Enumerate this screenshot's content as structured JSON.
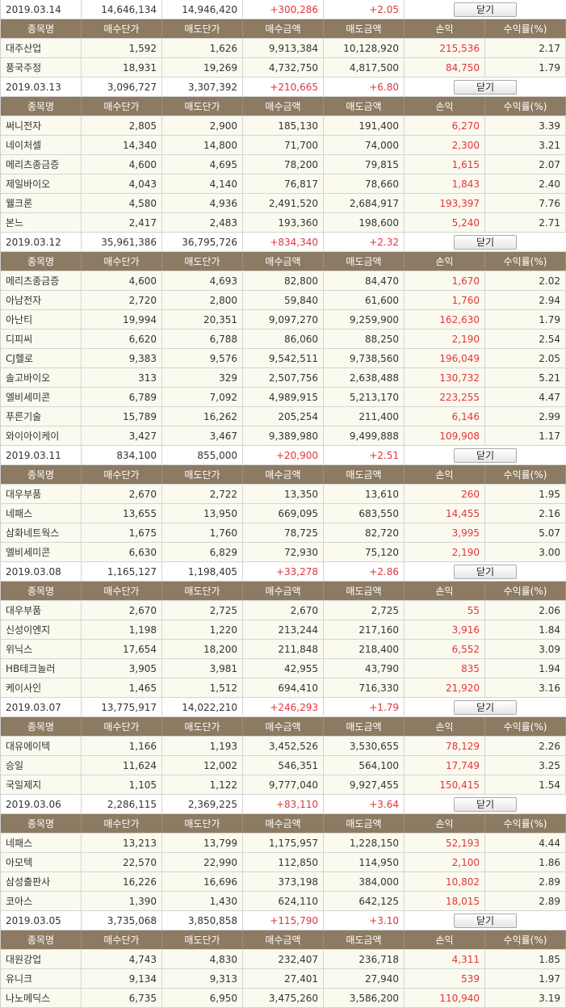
{
  "columns": [
    "종목명",
    "매수단가",
    "매도단가",
    "매수금액",
    "매도금액",
    "손익",
    "수익률(%)"
  ],
  "close_label": "닫기",
  "groups": [
    {
      "date": "2019.03.14",
      "buy_total": "14,646,134",
      "sell_total": "14,946,420",
      "profit": "+300,286",
      "rate": "+2.05",
      "rows": [
        [
          "대주산업",
          "1,592",
          "1,626",
          "9,913,384",
          "10,128,920",
          "215,536",
          "2.17"
        ],
        [
          "풍국주정",
          "18,931",
          "19,269",
          "4,732,750",
          "4,817,500",
          "84,750",
          "1.79"
        ]
      ]
    },
    {
      "date": "2019.03.13",
      "buy_total": "3,096,727",
      "sell_total": "3,307,392",
      "profit": "+210,665",
      "rate": "+6.80",
      "rows": [
        [
          "써니전자",
          "2,805",
          "2,900",
          "185,130",
          "191,400",
          "6,270",
          "3.39"
        ],
        [
          "네이처셀",
          "14,340",
          "14,800",
          "71,700",
          "74,000",
          "2,300",
          "3.21"
        ],
        [
          "메리츠종금증",
          "4,600",
          "4,695",
          "78,200",
          "79,815",
          "1,615",
          "2.07"
        ],
        [
          "제일바이오",
          "4,043",
          "4,140",
          "76,817",
          "78,660",
          "1,843",
          "2.40"
        ],
        [
          "웰크론",
          "4,580",
          "4,936",
          "2,491,520",
          "2,684,917",
          "193,397",
          "7.76"
        ],
        [
          "본느",
          "2,417",
          "2,483",
          "193,360",
          "198,600",
          "5,240",
          "2.71"
        ]
      ]
    },
    {
      "date": "2019.03.12",
      "buy_total": "35,961,386",
      "sell_total": "36,795,726",
      "profit": "+834,340",
      "rate": "+2.32",
      "rows": [
        [
          "메리츠종금증",
          "4,600",
          "4,693",
          "82,800",
          "84,470",
          "1,670",
          "2.02"
        ],
        [
          "아남전자",
          "2,720",
          "2,800",
          "59,840",
          "61,600",
          "1,760",
          "2.94"
        ],
        [
          "아난티",
          "19,994",
          "20,351",
          "9,097,270",
          "9,259,900",
          "162,630",
          "1.79"
        ],
        [
          "디피씨",
          "6,620",
          "6,788",
          "86,060",
          "88,250",
          "2,190",
          "2.54"
        ],
        [
          "CJ헬로",
          "9,383",
          "9,576",
          "9,542,511",
          "9,738,560",
          "196,049",
          "2.05"
        ],
        [
          "솔고바이오",
          "313",
          "329",
          "2,507,756",
          "2,638,488",
          "130,732",
          "5.21"
        ],
        [
          "엘비세미콘",
          "6,789",
          "7,092",
          "4,989,915",
          "5,213,170",
          "223,255",
          "4.47"
        ],
        [
          "푸른기술",
          "15,789",
          "16,262",
          "205,254",
          "211,400",
          "6,146",
          "2.99"
        ],
        [
          "와이아이케이",
          "3,427",
          "3,467",
          "9,389,980",
          "9,499,888",
          "109,908",
          "1.17"
        ]
      ]
    },
    {
      "date": "2019.03.11",
      "buy_total": "834,100",
      "sell_total": "855,000",
      "profit": "+20,900",
      "rate": "+2.51",
      "rows": [
        [
          "대우부품",
          "2,670",
          "2,722",
          "13,350",
          "13,610",
          "260",
          "1.95"
        ],
        [
          "네패스",
          "13,655",
          "13,950",
          "669,095",
          "683,550",
          "14,455",
          "2.16"
        ],
        [
          "삼화네트웍스",
          "1,675",
          "1,760",
          "78,725",
          "82,720",
          "3,995",
          "5.07"
        ],
        [
          "엘비세미콘",
          "6,630",
          "6,829",
          "72,930",
          "75,120",
          "2,190",
          "3.00"
        ]
      ]
    },
    {
      "date": "2019.03.08",
      "buy_total": "1,165,127",
      "sell_total": "1,198,405",
      "profit": "+33,278",
      "rate": "+2.86",
      "rows": [
        [
          "대우부품",
          "2,670",
          "2,725",
          "2,670",
          "2,725",
          "55",
          "2.06"
        ],
        [
          "신성이엔지",
          "1,198",
          "1,220",
          "213,244",
          "217,160",
          "3,916",
          "1.84"
        ],
        [
          "위닉스",
          "17,654",
          "18,200",
          "211,848",
          "218,400",
          "6,552",
          "3.09"
        ],
        [
          "HB테크놀러",
          "3,905",
          "3,981",
          "42,955",
          "43,790",
          "835",
          "1.94"
        ],
        [
          "케이사인",
          "1,465",
          "1,512",
          "694,410",
          "716,330",
          "21,920",
          "3.16"
        ]
      ]
    },
    {
      "date": "2019.03.07",
      "buy_total": "13,775,917",
      "sell_total": "14,022,210",
      "profit": "+246,293",
      "rate": "+1.79",
      "rows": [
        [
          "대유에이텍",
          "1,166",
          "1,193",
          "3,452,526",
          "3,530,655",
          "78,129",
          "2.26"
        ],
        [
          "승일",
          "11,624",
          "12,002",
          "546,351",
          "564,100",
          "17,749",
          "3.25"
        ],
        [
          "국일제지",
          "1,105",
          "1,122",
          "9,777,040",
          "9,927,455",
          "150,415",
          "1.54"
        ]
      ]
    },
    {
      "date": "2019.03.06",
      "buy_total": "2,286,115",
      "sell_total": "2,369,225",
      "profit": "+83,110",
      "rate": "+3.64",
      "rows": [
        [
          "네패스",
          "13,213",
          "13,799",
          "1,175,957",
          "1,228,150",
          "52,193",
          "4.44"
        ],
        [
          "아모텍",
          "22,570",
          "22,990",
          "112,850",
          "114,950",
          "2,100",
          "1.86"
        ],
        [
          "삼성출판사",
          "16,226",
          "16,696",
          "373,198",
          "384,000",
          "10,802",
          "2.89"
        ],
        [
          "코아스",
          "1,390",
          "1,430",
          "624,110",
          "642,125",
          "18,015",
          "2.89"
        ]
      ]
    },
    {
      "date": "2019.03.05",
      "buy_total": "3,735,068",
      "sell_total": "3,850,858",
      "profit": "+115,790",
      "rate": "+3.10",
      "rows": [
        [
          "대원강업",
          "4,743",
          "4,830",
          "232,407",
          "236,718",
          "4,311",
          "1.85"
        ],
        [
          "유니크",
          "9,134",
          "9,313",
          "27,401",
          "27,940",
          "539",
          "1.97"
        ],
        [
          "나노메딕스",
          "6,735",
          "6,950",
          "3,475,260",
          "3,586,200",
          "110,940",
          "3.19"
        ]
      ]
    }
  ]
}
